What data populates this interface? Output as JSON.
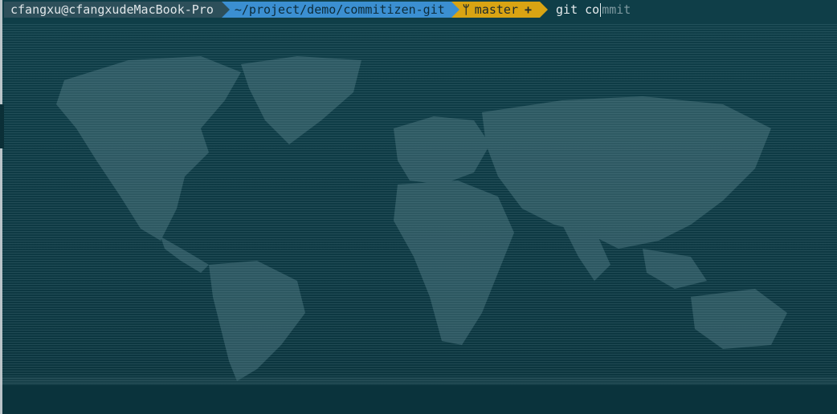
{
  "terminal": {
    "prompt": {
      "user_host": "cfangxu@cfangxudeMacBook-Pro",
      "path": "~/project/demo/commitizen-git",
      "git": {
        "branch_icon": "branch-icon",
        "branch_glyph": "ᛘ",
        "branch": "master",
        "status_icon": "plus-icon",
        "status_glyph": "+"
      }
    },
    "command": {
      "typed": "git co",
      "suggestion": "mmit"
    },
    "colors": {
      "background": "#0e3b45",
      "user_segment": "#2d4f5a",
      "path_segment": "#3b8fd1",
      "git_segment": "#d9a413",
      "map_land": "#4f7a82"
    },
    "background_image": "world-map"
  }
}
